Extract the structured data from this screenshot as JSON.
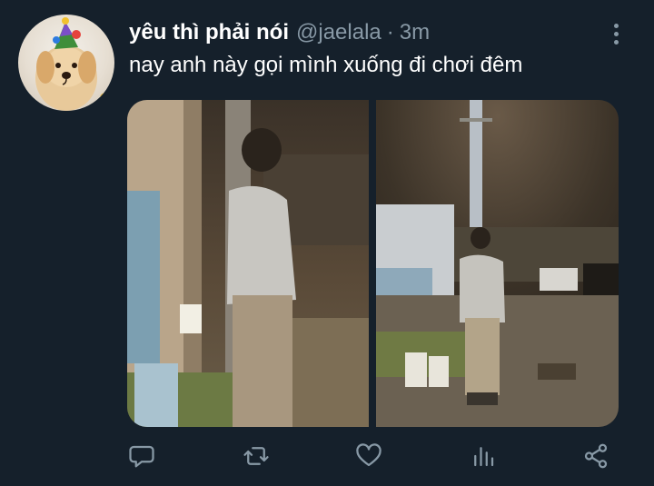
{
  "tweet": {
    "display_name": "yêu thì phải nói",
    "handle": "@jaelala",
    "separator": "·",
    "timestamp": "3m",
    "text": "nay anh này gọi mình xuống đi chơi đêm"
  },
  "avatar": {
    "icon": "puppy-with-party-hat"
  },
  "media": {
    "count": 2,
    "photos": [
      {
        "description_icon": "photo-night-street-left"
      },
      {
        "description_icon": "photo-night-street-right"
      }
    ]
  },
  "actions": [
    {
      "name": "reply",
      "icon": "reply-icon"
    },
    {
      "name": "retweet",
      "icon": "retweet-icon"
    },
    {
      "name": "like",
      "icon": "heart-icon"
    },
    {
      "name": "analytics",
      "icon": "analytics-icon"
    },
    {
      "name": "share",
      "icon": "share-icon"
    }
  ],
  "colors": {
    "background": "#15202b",
    "text_primary": "#ffffff",
    "text_secondary": "#8899a6"
  }
}
